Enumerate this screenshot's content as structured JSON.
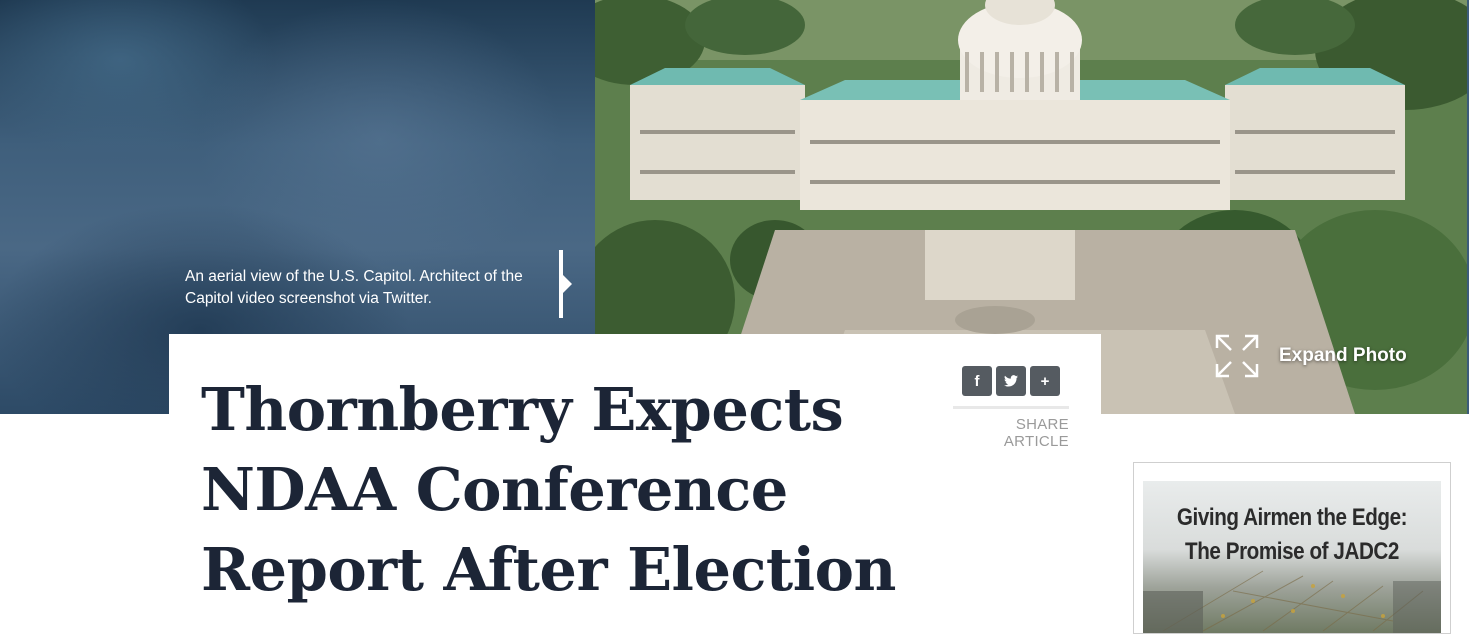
{
  "hero": {
    "caption": "An aerial view of the U.S. Capitol. Architect of the Capitol video screenshot via Twitter.",
    "expand_label": "Expand Photo"
  },
  "article": {
    "headline": "Thornberry Expects NDAA Conference Report After Election",
    "share": {
      "label": "SHARE ARTICLE",
      "facebook": "f",
      "twitter": "t",
      "more": "+"
    }
  },
  "ad": {
    "line1": "Giving Airmen the Edge:",
    "line2": "The Promise of JADC2"
  }
}
